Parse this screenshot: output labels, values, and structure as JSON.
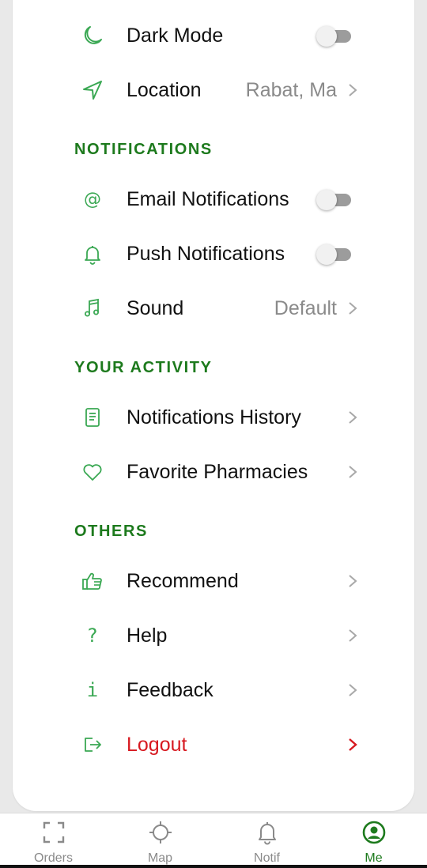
{
  "colors": {
    "accent": "#1d7a1d",
    "icon": "#3aa853",
    "danger": "#d71920",
    "muted": "#8a8a8a"
  },
  "settings": {
    "dark_mode": {
      "label": "Dark Mode",
      "icon": "moon-icon",
      "enabled": false
    },
    "location": {
      "label": "Location",
      "value": "Rabat, Ma",
      "icon": "navigation-arrow-icon"
    }
  },
  "notifications": {
    "title": "NOTIFICATIONS",
    "email": {
      "label": "Email Notifications",
      "icon": "at-sign-icon",
      "enabled": false
    },
    "push": {
      "label": "Push Notifications",
      "icon": "bell-icon",
      "enabled": false
    },
    "sound": {
      "label": "Sound",
      "value": "Default",
      "icon": "music-note-icon"
    }
  },
  "activity": {
    "title": "YOUR ACTIVITY",
    "history": {
      "label": "Notifications History",
      "icon": "document-icon"
    },
    "favorites": {
      "label": "Favorite Pharmacies",
      "icon": "heart-icon"
    }
  },
  "others": {
    "title": "OTHERS",
    "recommend": {
      "label": "Recommend",
      "icon": "thumbs-up-icon"
    },
    "help": {
      "label": "Help",
      "icon": "question-icon"
    },
    "feedback": {
      "label": "Feedback",
      "icon": "info-icon"
    },
    "logout": {
      "label": "Logout",
      "icon": "logout-icon"
    }
  },
  "tabbar": {
    "tabs": [
      {
        "label": "Orders",
        "icon": "scan-frame-icon",
        "active": false
      },
      {
        "label": "Map",
        "icon": "crosshair-icon",
        "active": false
      },
      {
        "label": "Notif",
        "icon": "bell-icon",
        "active": false
      },
      {
        "label": "Me",
        "icon": "user-circle-icon",
        "active": true
      }
    ]
  }
}
